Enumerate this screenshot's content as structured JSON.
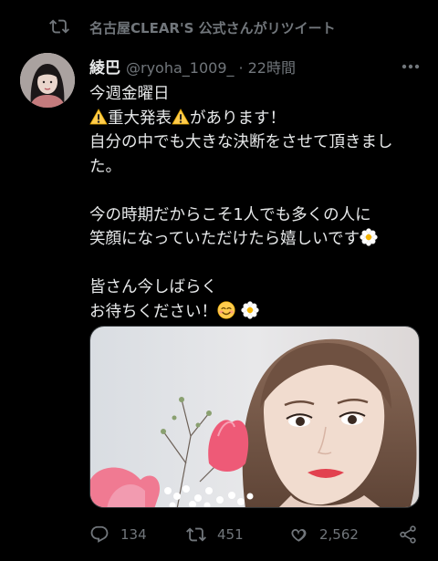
{
  "retweet": {
    "label": "名古屋CLEAR'S 公式さんがリツイート",
    "icon": "retweet-icon"
  },
  "tweet": {
    "display_name": "綾巴",
    "handle": "@ryoha_1009_",
    "separator": "·",
    "time": "22時間",
    "lines": {
      "l1": "今週金曜日",
      "l2a": "重大発表",
      "l2b": "があります！",
      "l3": "自分の中でも大きな決断をさせて頂きまし",
      "l4": "た。",
      "l5": "今の時期だからこそ1人でも多くの人に",
      "l6": "笑顔になっていただけたら嬉しいです",
      "l7": "皆さん今しばらく",
      "l8": "お待ちください！"
    },
    "emoji": [
      "warning-icon",
      "blossom-icon",
      "smiling-face-icon"
    ]
  },
  "actions": {
    "reply_count": "134",
    "retweet_count": "451",
    "like_count": "2,562"
  },
  "colors": {
    "background": "#000000",
    "text": "#e7e9ea",
    "muted": "#71767b"
  }
}
